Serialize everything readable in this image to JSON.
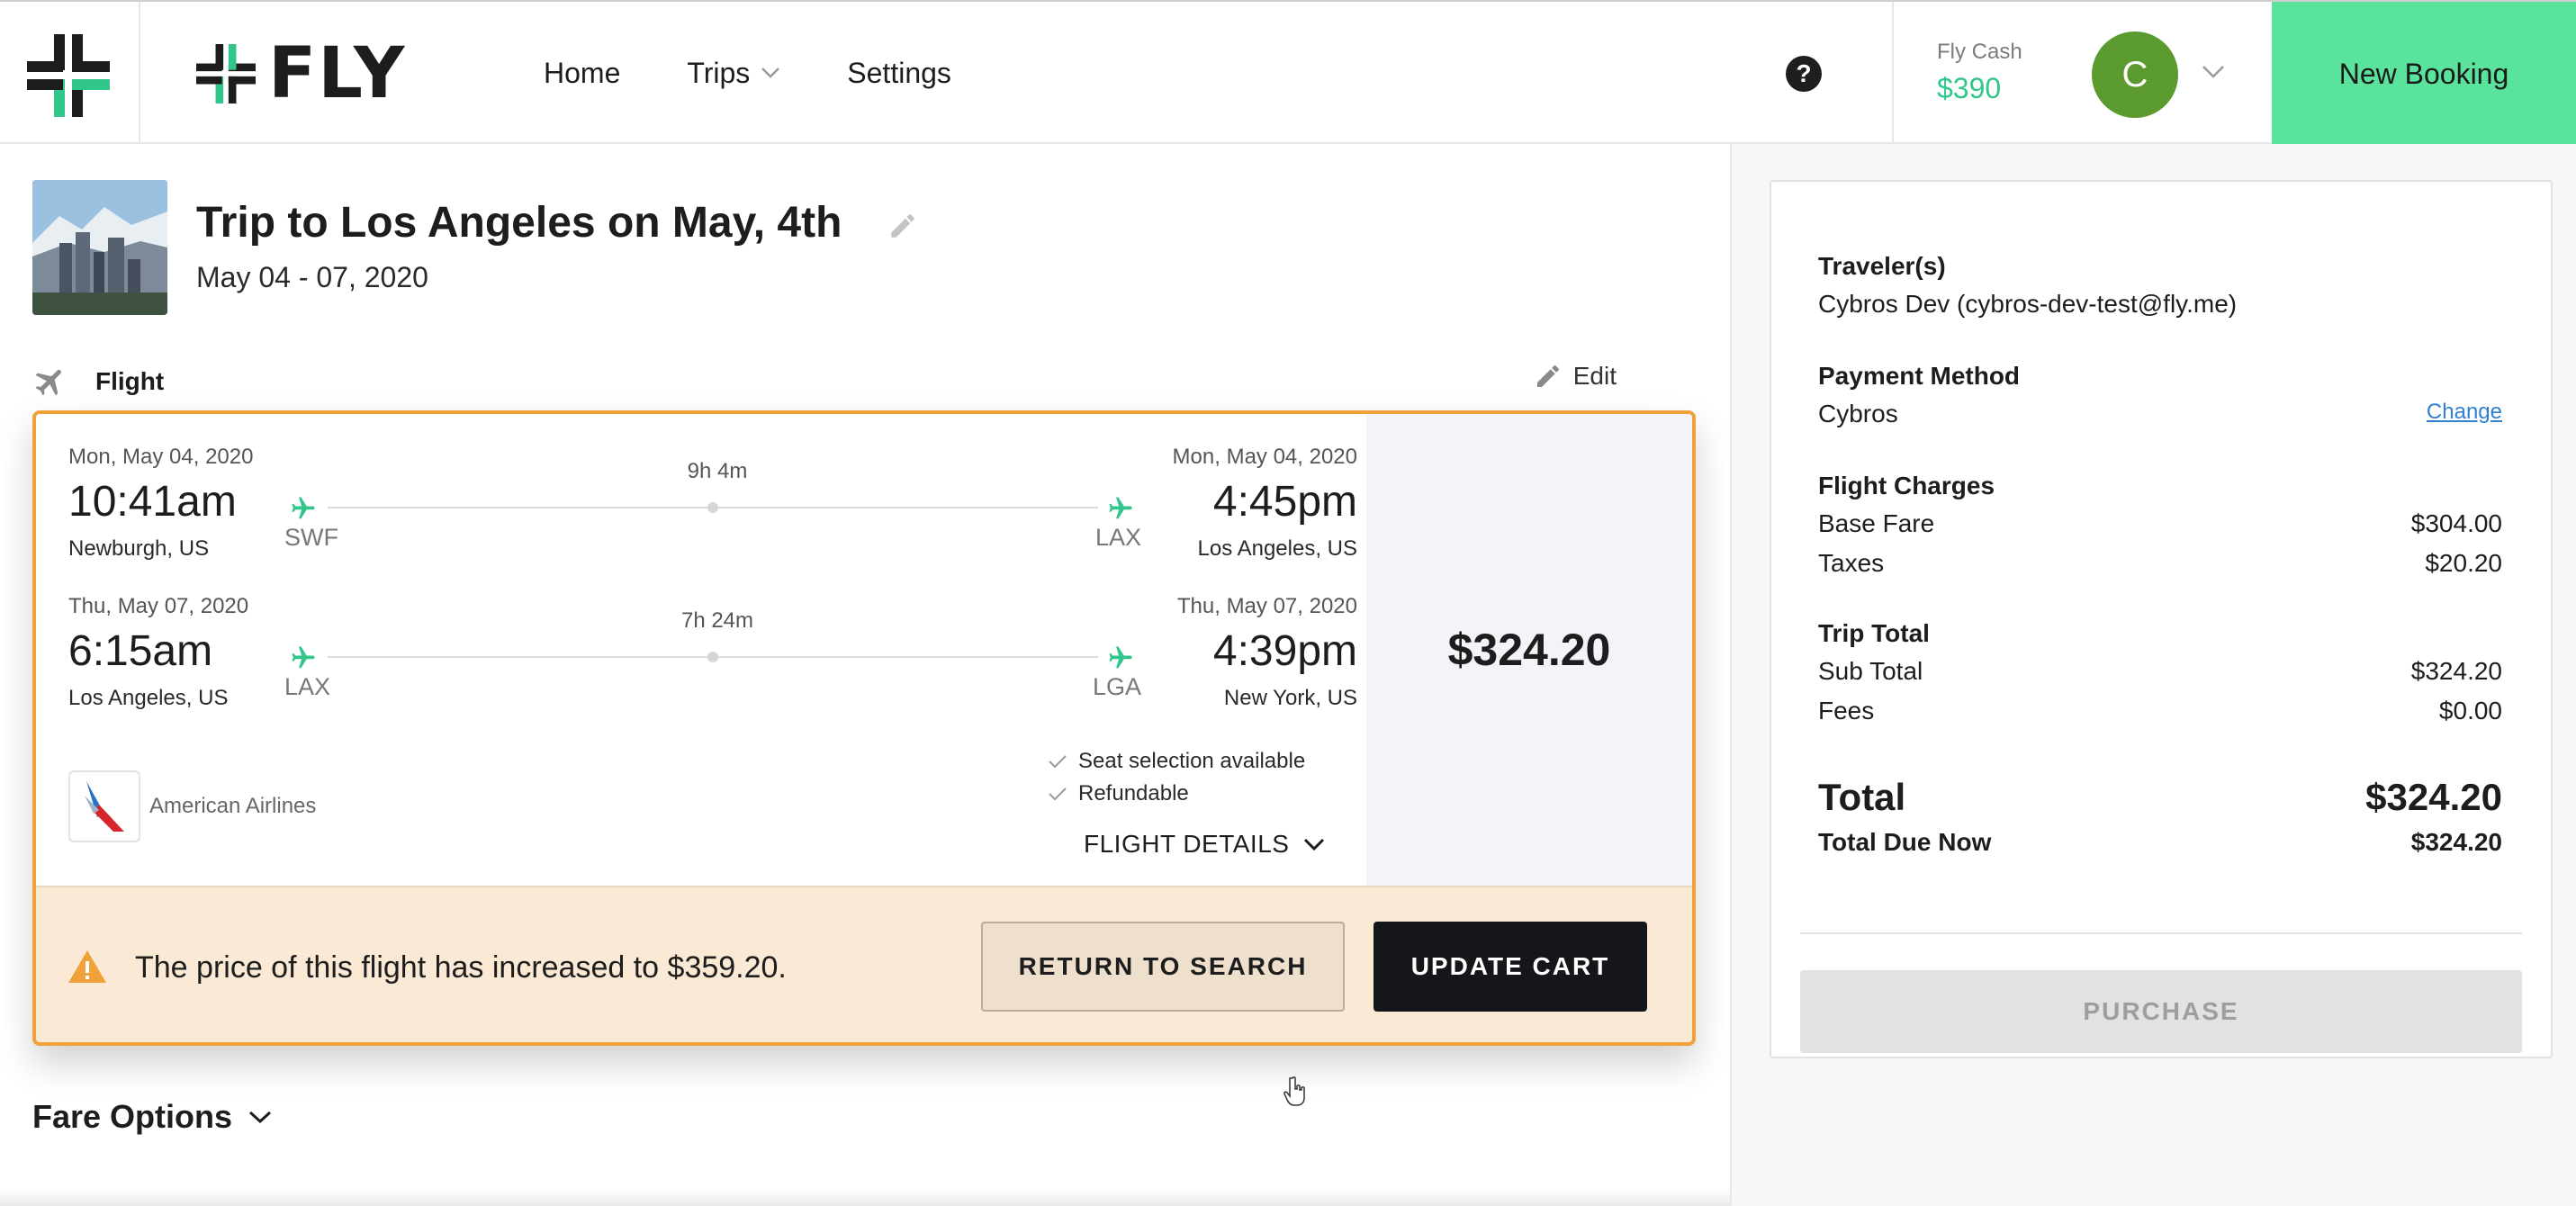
{
  "app": {
    "brand": "FLY"
  },
  "nav": {
    "home": "Home",
    "trips": "Trips",
    "settings": "Settings"
  },
  "header": {
    "help": "?",
    "fly_cash_label": "Fly Cash",
    "fly_cash_value": "$390",
    "avatar_initial": "C",
    "new_booking": "New Booking"
  },
  "trip": {
    "title": "Trip to Los Angeles on May, 4th",
    "dates": "May 04 - 07, 2020"
  },
  "flight_section": {
    "label": "Flight",
    "edit": "Edit"
  },
  "legs": [
    {
      "depart_date": "Mon, May 04, 2020",
      "depart_time": "10:41am",
      "depart_city": "Newburgh, US",
      "depart_code": "SWF",
      "duration": "9h 4m",
      "arrive_code": "LAX",
      "arrive_date": "Mon, May 04, 2020",
      "arrive_time": "4:45pm",
      "arrive_city": "Los Angeles, US"
    },
    {
      "depart_date": "Thu, May 07, 2020",
      "depart_time": "6:15am",
      "depart_city": "Los Angeles, US",
      "depart_code": "LAX",
      "duration": "7h 24m",
      "arrive_code": "LGA",
      "arrive_date": "Thu, May 07, 2020",
      "arrive_time": "4:39pm",
      "arrive_city": "New York, US"
    }
  ],
  "airline": {
    "name": "American Airlines"
  },
  "features": [
    "Seat selection available",
    "Refundable"
  ],
  "flight_details": "FLIGHT DETAILS",
  "price": "$324.20",
  "warning": {
    "text": "The price of this flight has increased to $359.20.",
    "return_button": "RETURN TO SEARCH",
    "update_button": "UPDATE CART"
  },
  "fare_options": "Fare Options",
  "summary": {
    "travelers_label": "Traveler(s)",
    "travelers_value": "Cybros Dev (cybros-dev-test@fly.me)",
    "payment_label": "Payment Method",
    "payment_value": "Cybros",
    "change": "Change",
    "flight_charges_label": "Flight Charges",
    "base_fare_label": "Base Fare",
    "base_fare_value": "$304.00",
    "taxes_label": "Taxes",
    "taxes_value": "$20.20",
    "trip_total_label": "Trip Total",
    "sub_total_label": "Sub Total",
    "sub_total_value": "$324.20",
    "fees_label": "Fees",
    "fees_value": "$0.00",
    "total_label": "Total",
    "total_value": "$324.20",
    "total_due_label": "Total Due Now",
    "total_due_value": "$324.20",
    "purchase": "PURCHASE"
  },
  "colors": {
    "accent_green": "#59e39c",
    "cash_green": "#32c68a",
    "warning_orange": "#f0a13a",
    "warning_bg": "#fae9d4",
    "avatar_green": "#5b9a2e",
    "link_blue": "#2f7fd3"
  }
}
